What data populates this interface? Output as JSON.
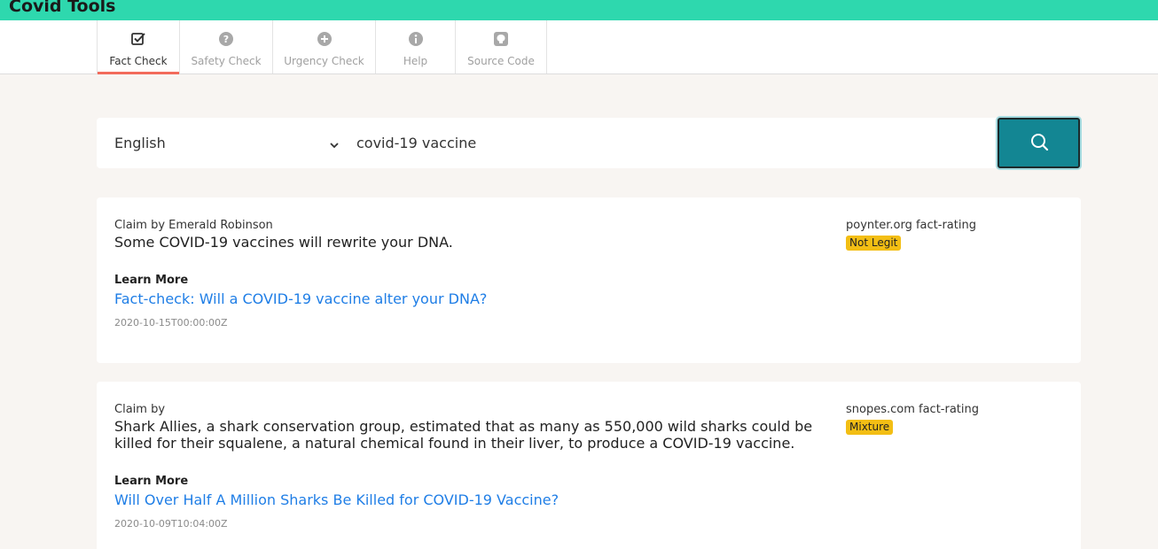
{
  "app": {
    "title": "Covid Tools"
  },
  "nav": {
    "tabs": [
      {
        "label": "Fact Check",
        "icon": "checkbox-icon",
        "active": true
      },
      {
        "label": "Safety Check",
        "icon": "question-circle-icon",
        "active": false
      },
      {
        "label": "Urgency Check",
        "icon": "plus-circle-icon",
        "active": false
      },
      {
        "label": "Help",
        "icon": "info-circle-icon",
        "active": false
      },
      {
        "label": "Source Code",
        "icon": "github-icon",
        "active": false
      }
    ]
  },
  "search": {
    "language": "English",
    "query": "covid-19 vaccine",
    "button_icon": "search-icon"
  },
  "results": [
    {
      "claim_by": "Claim by Emerald Robinson",
      "claim": "Some COVID-19 vaccines will rewrite your DNA.",
      "learn_more": "Learn More",
      "link_text": "Fact-check: Will a COVID-19 vaccine alter your DNA?",
      "date": "2020-10-15T00:00:00Z",
      "rating_source": "poynter.org fact-rating",
      "rating": "Not Legit"
    },
    {
      "claim_by": "Claim by",
      "claim": "Shark Allies, a shark conservation group, estimated that as many as 550,000 wild sharks could be killed for their squalene, a natural chemical found in their liver, to produce a COVID-19 vaccine.",
      "learn_more": "Learn More",
      "link_text": "Will Over Half A Million Sharks Be Killed for COVID-19 Vaccine?",
      "date": "2020-10-09T10:04:00Z",
      "rating_source": "snopes.com fact-rating",
      "rating": "Mixture"
    }
  ],
  "colors": {
    "topbar": "#2ed8ae",
    "accent": "#138693",
    "active_tab_underline": "#f26b5b",
    "badge": "#f3be14",
    "link": "#1f7ee6"
  }
}
